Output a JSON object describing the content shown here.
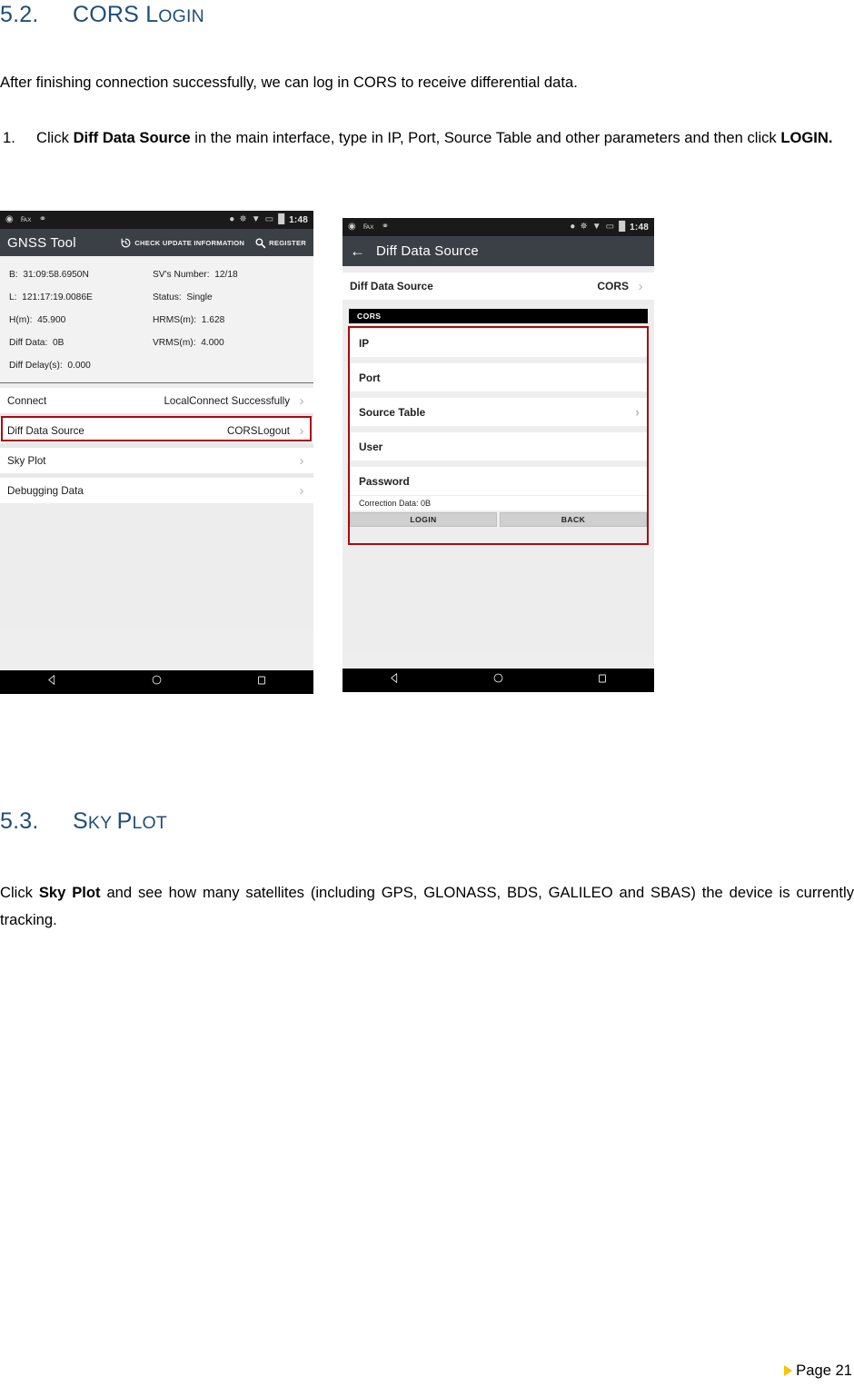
{
  "document": {
    "section_5_2": {
      "number": "5.2.",
      "title_cap": "CORS",
      "title_small": "LOGIN",
      "intro": "After finishing connection successfully, we can log in CORS to receive differential data.",
      "step_1": {
        "marker": "1.",
        "text_a": "Click ",
        "bold_a": "Diff Data Source",
        "text_b": " in the main interface, type in IP, Port, Source Table and other parameters and then click ",
        "bold_b": "LOGIN."
      }
    },
    "section_5_3": {
      "number": "5.3.",
      "title_cap": "S",
      "title_small": "KY ",
      "title_cap2": "P",
      "title_small2": "LOT",
      "body_a": "Click ",
      "body_bold": "Sky Plot",
      "body_b": " and see how many satellites (including GPS, GLONASS, BDS, GALILEO and SBAS) the device is currently tracking."
    },
    "footer": {
      "page_label": "Page 21"
    },
    "colors": {
      "heading": "#1F4E79",
      "highlight_box": "#A80B0B",
      "footer_marker": "#FFC000"
    }
  },
  "phone_left": {
    "status_bar": {
      "left_icons": [
        "sync-icon",
        "usb-icon",
        "usb-plug-icon"
      ],
      "right_icons": [
        "location-icon",
        "bluetooth-icon",
        "wifi-icon",
        "sim-icon",
        "battery-icon"
      ],
      "time": "1:48"
    },
    "app_bar": {
      "title": "GNSS Tool",
      "action_update": "CHECK UPDATE INFORMATION",
      "action_register": "REGISTER"
    },
    "info": [
      {
        "label": "B:",
        "value": "31:09:58.6950N",
        "label2": "SV's Number:",
        "value2": "12/18"
      },
      {
        "label": "L:",
        "value": "121:17:19.0086E",
        "label2": "Status:",
        "value2": "Single"
      },
      {
        "label": "H(m):",
        "value": "45.900",
        "label2": "HRMS(m):",
        "value2": "1.628"
      },
      {
        "label": "Diff Data:",
        "value": "0B",
        "label2": "VRMS(m):",
        "value2": "4.000"
      },
      {
        "label": "Diff Delay(s):",
        "value": "0.000",
        "label2": "",
        "value2": ""
      }
    ],
    "menu": [
      {
        "label": "Connect",
        "value": "LocalConnect Successfully"
      },
      {
        "label": "Diff Data Source",
        "value": "CORSLogout"
      },
      {
        "label": "Sky Plot",
        "value": ""
      },
      {
        "label": "Debugging Data",
        "value": ""
      }
    ],
    "nav": [
      "back-triangle-icon",
      "home-circle-icon",
      "recents-square-icon"
    ]
  },
  "phone_right": {
    "status_bar": {
      "left_icons": [
        "sync-icon",
        "usb-icon",
        "usb-plug-icon"
      ],
      "right_icons": [
        "location-icon",
        "bluetooth-icon",
        "wifi-icon",
        "sim-icon",
        "battery-icon"
      ],
      "time": "1:48"
    },
    "app_bar": {
      "back": "back-arrow-icon",
      "title": "Diff Data Source"
    },
    "source_row": {
      "label": "Diff Data Source",
      "value": "CORS"
    },
    "group_header": "CORS",
    "fields": [
      {
        "label": "IP",
        "chevron": false
      },
      {
        "label": "Port",
        "chevron": false
      },
      {
        "label": "Source Table",
        "chevron": true
      },
      {
        "label": "User",
        "chevron": false
      },
      {
        "label": "Password",
        "chevron": false
      }
    ],
    "correction": "Correction Data:  0B",
    "buttons": {
      "login": "LOGIN",
      "back": "BACK"
    },
    "nav": [
      "back-triangle-icon",
      "home-circle-icon",
      "recents-square-icon"
    ]
  }
}
